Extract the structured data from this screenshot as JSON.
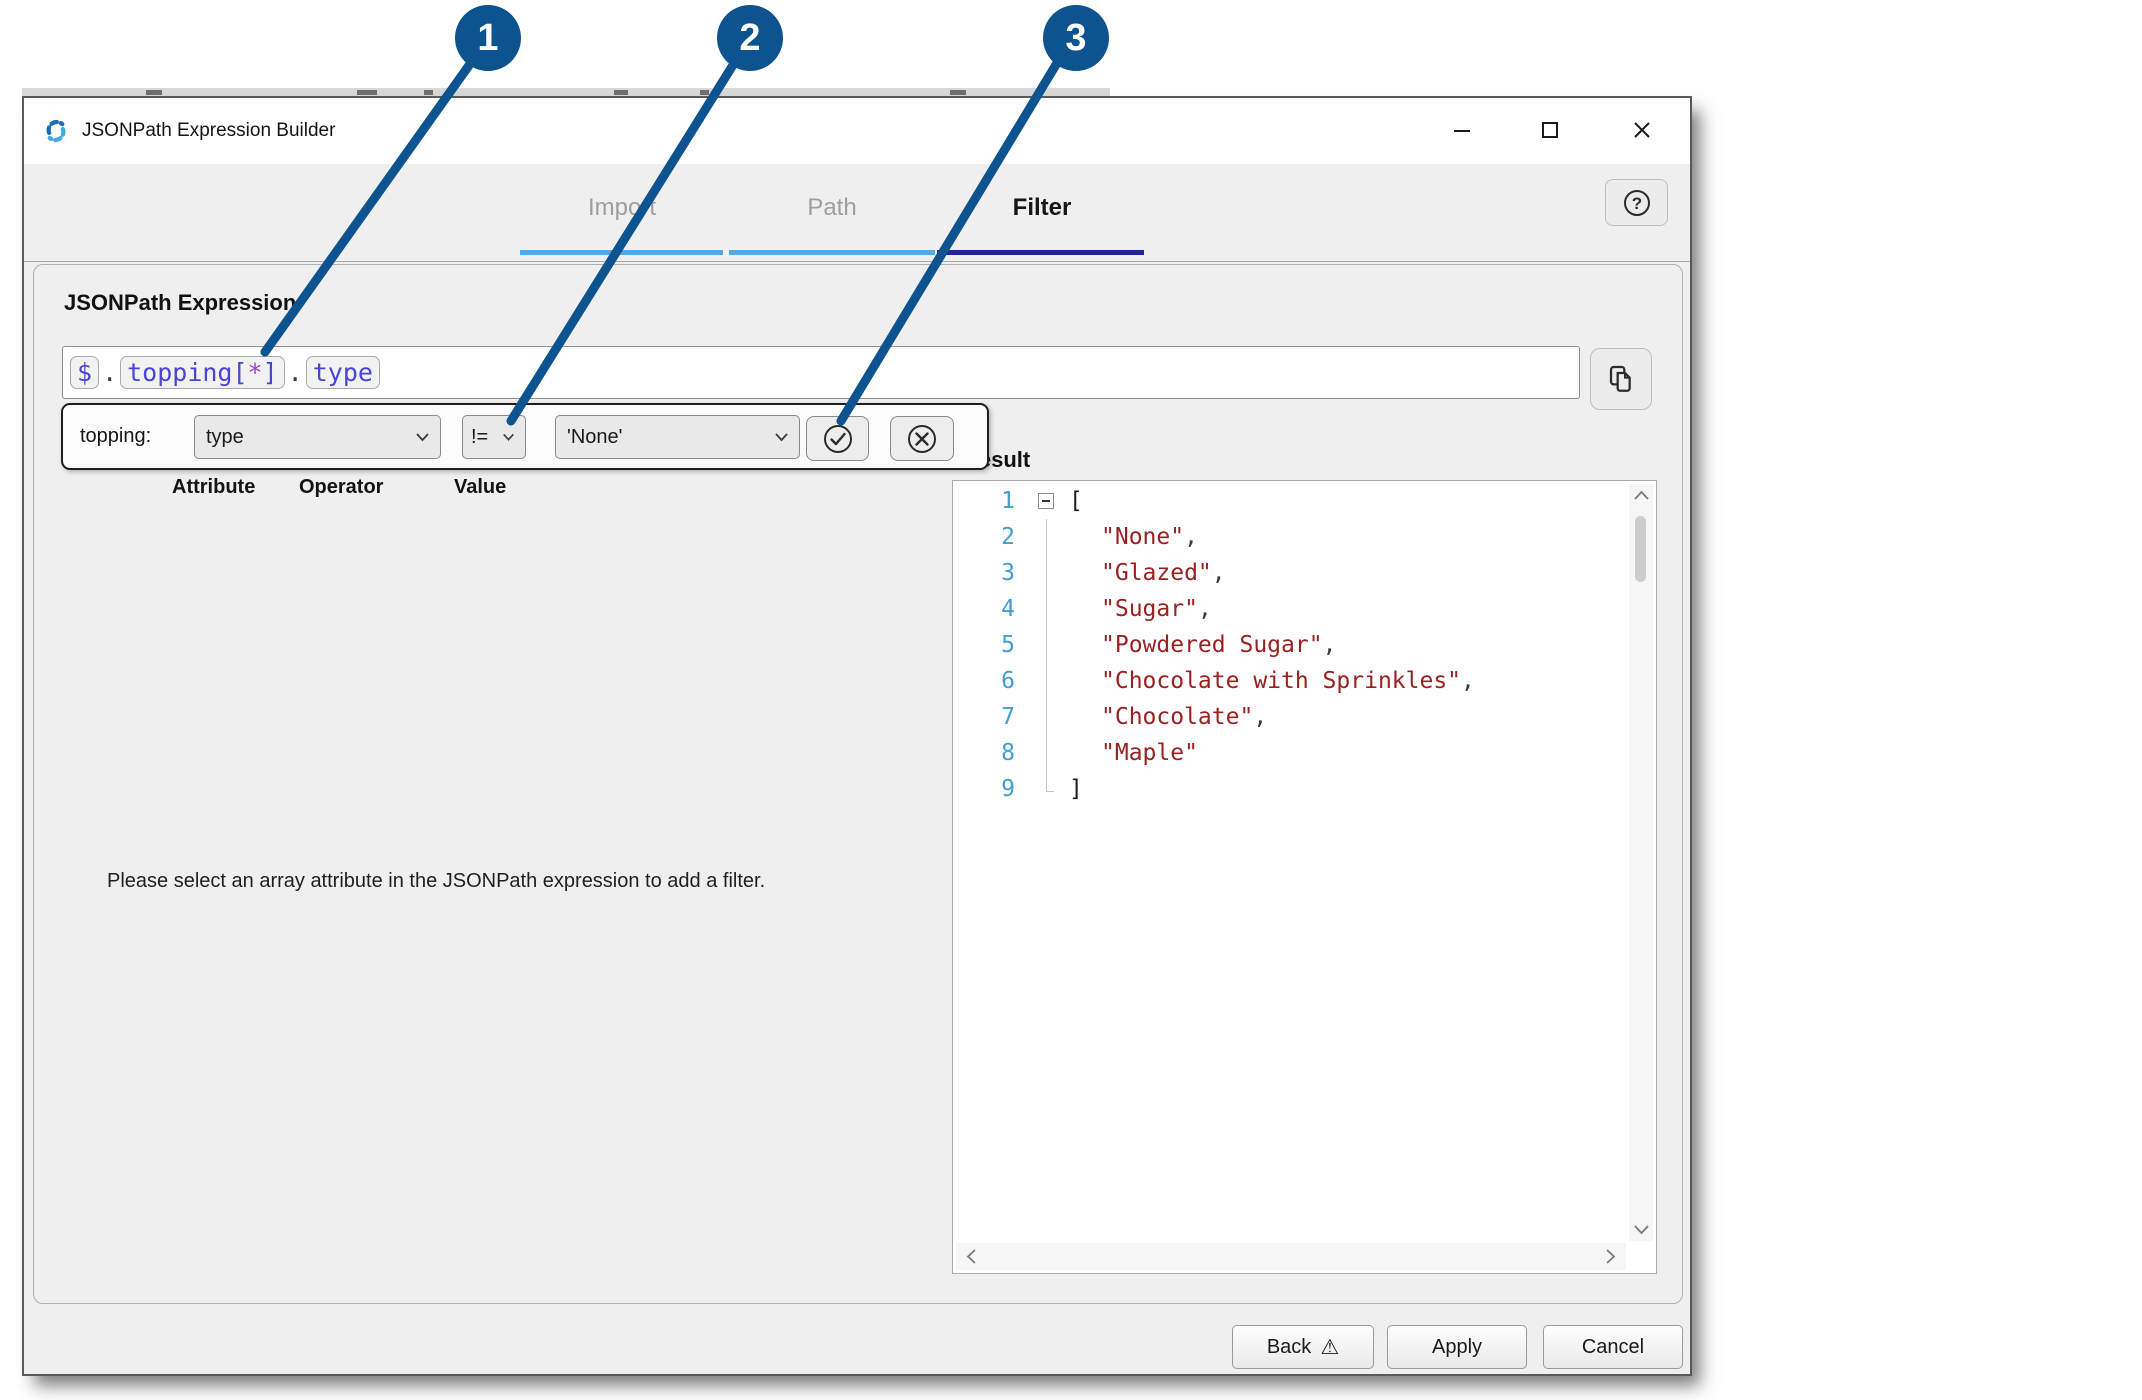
{
  "window": {
    "title": "JSONPath Expression Builder"
  },
  "tabs": [
    {
      "label": "Import",
      "active": false
    },
    {
      "label": "Path",
      "active": false
    },
    {
      "label": "Filter",
      "active": true
    }
  ],
  "expression": {
    "section_label": "JSONPath Expression",
    "dollar": "$",
    "dot1": ".",
    "array_segment_pre": "topping[",
    "array_segment_star": "*",
    "array_segment_post": "]",
    "dot2": ".",
    "property": "type"
  },
  "filter": {
    "scope_label": "topping:",
    "attribute_value": "type",
    "operator_value": "!=",
    "value_value": "'None'",
    "column_headers": [
      "Attribute",
      "Operator",
      "Value"
    ]
  },
  "result": {
    "label": "Result",
    "lines": [
      {
        "num": "1",
        "kind": "open",
        "text": "[",
        "suffix": ""
      },
      {
        "num": "2",
        "kind": "str",
        "text": "\"None\"",
        "suffix": ","
      },
      {
        "num": "3",
        "kind": "str",
        "text": "\"Glazed\"",
        "suffix": ","
      },
      {
        "num": "4",
        "kind": "str",
        "text": "\"Sugar\"",
        "suffix": ","
      },
      {
        "num": "5",
        "kind": "str",
        "text": "\"Powdered Sugar\"",
        "suffix": ","
      },
      {
        "num": "6",
        "kind": "str",
        "text": "\"Chocolate with Sprinkles\"",
        "suffix": ","
      },
      {
        "num": "7",
        "kind": "str",
        "text": "\"Chocolate\"",
        "suffix": ","
      },
      {
        "num": "8",
        "kind": "str",
        "text": "\"Maple\"",
        "suffix": ""
      },
      {
        "num": "9",
        "kind": "close",
        "text": "]",
        "suffix": ""
      }
    ]
  },
  "message": {
    "text": "Please select an array attribute in the JSONPath expression to add a filter."
  },
  "footer": {
    "back": "Back",
    "warning_glyph": "⚠",
    "apply": "Apply",
    "cancel": "Cancel"
  },
  "callouts": [
    {
      "number": "1"
    },
    {
      "number": "2"
    },
    {
      "number": "3"
    }
  ],
  "colors": {
    "callout_blue": "#0d5390",
    "tab_active_underline": "#23268f",
    "tab_inactive_underline": "#55a8e2",
    "token_blue": "#4a43d6",
    "star_purple": "#9d3fd0",
    "string_red": "#9b2121",
    "line_number_blue": "#3f9fd0"
  }
}
